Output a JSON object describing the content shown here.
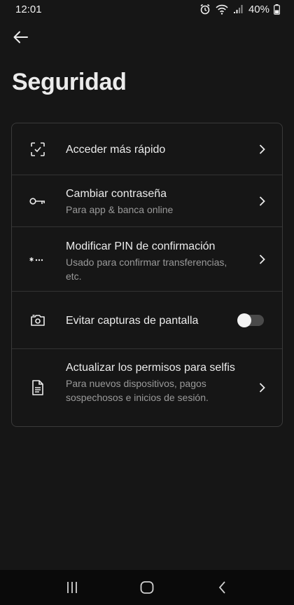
{
  "status_bar": {
    "time": "12:01",
    "battery": "40%",
    "icons": [
      "alarm-icon",
      "wifi-icon",
      "signal-icon",
      "battery-icon"
    ]
  },
  "header": {
    "back_icon": "arrow-left-icon",
    "title": "Seguridad"
  },
  "settings": {
    "items": [
      {
        "icon": "face-scan-icon",
        "title": "Acceder más rápido",
        "subtitle": ""
      },
      {
        "icon": "key-icon",
        "title": "Cambiar contraseña",
        "subtitle": "Para app & banca online"
      },
      {
        "icon": "pin-dots-icon",
        "title": "Modificar PIN de confirmación",
        "subtitle": "Usado para confirmar transferencias, etc."
      },
      {
        "icon": "camera-icon",
        "title": "Evitar capturas de pantalla",
        "subtitle": "",
        "toggle_on": false
      },
      {
        "icon": "document-icon",
        "title": "Actualizar los permisos para selfis",
        "subtitle": "Para nuevos dispositivos, pagos sospechosos e inicios de sesión."
      }
    ]
  },
  "nav_bar": {
    "icons": [
      "recent-apps-icon",
      "home-icon",
      "back-nav-icon"
    ]
  },
  "colors": {
    "background": "#161616",
    "card_border": "#3a3a3a",
    "text_primary": "#ececec",
    "text_secondary": "#9a9a9a"
  }
}
